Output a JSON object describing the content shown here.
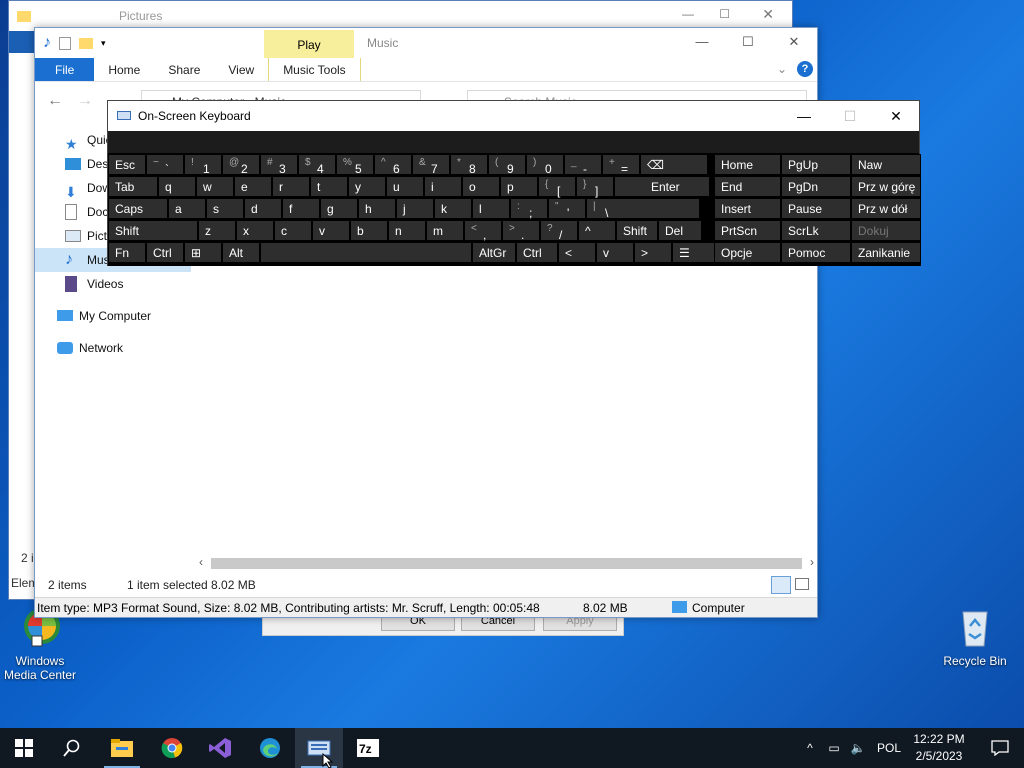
{
  "back_window": {
    "title": "Pictures"
  },
  "main_window": {
    "title": "Music",
    "context_tab": "Play",
    "ribbon_tabs": [
      "File",
      "Home",
      "Share",
      "View",
      "Music Tools"
    ],
    "address": "My Computer › Music",
    "search_placeholder": "Search Music",
    "nav_items": [
      {
        "label": "Quick access",
        "icon": "star-icon"
      },
      {
        "label": "Desktop",
        "icon": "desktop-icon"
      },
      {
        "label": "Downloads",
        "icon": "download-icon"
      },
      {
        "label": "Documents",
        "icon": "document-icon"
      },
      {
        "label": "Pictures",
        "icon": "pictures-icon",
        "pinned": true
      },
      {
        "label": "Music",
        "icon": "music-icon",
        "selected": true
      },
      {
        "label": "Videos",
        "icon": "video-icon"
      },
      {
        "label": "My Computer",
        "icon": "computer-icon"
      },
      {
        "label": "Network",
        "icon": "network-icon"
      }
    ],
    "status": {
      "items": "2 items",
      "selected": "1 item selected  8.02 MB"
    },
    "info": {
      "details": "Item type: MP3 Format Sound, Size: 8.02 MB, Contributing artists: Mr. Scruff, Length: 00:05:48",
      "size": "8.02 MB",
      "location": "Computer"
    }
  },
  "back_dialog": {
    "ok": "OK",
    "cancel": "Cancel",
    "apply": "Apply"
  },
  "back_window_side": {
    "items_count": "2 i",
    "elem": "Elem"
  },
  "osk": {
    "title": "On-Screen Keyboard",
    "rows": [
      [
        {
          "t": "Esc"
        },
        {
          "s": "~",
          "m": "`"
        },
        {
          "s": "!",
          "m": "1"
        },
        {
          "s": "@",
          "m": "2"
        },
        {
          "s": "#",
          "m": "3"
        },
        {
          "s": "$",
          "m": "4"
        },
        {
          "s": "%",
          "m": "5"
        },
        {
          "s": "^",
          "m": "6"
        },
        {
          "s": "&",
          "m": "7"
        },
        {
          "s": "*",
          "m": "8"
        },
        {
          "s": "(",
          "m": "9"
        },
        {
          "s": ")",
          "m": "0"
        },
        {
          "s": "_",
          "m": "-"
        },
        {
          "s": "+",
          "m": "="
        },
        {
          "t": "⌫"
        }
      ],
      [
        {
          "t": "Tab"
        },
        {
          "t": "q"
        },
        {
          "t": "w"
        },
        {
          "t": "e"
        },
        {
          "t": "r"
        },
        {
          "t": "t"
        },
        {
          "t": "y"
        },
        {
          "t": "u"
        },
        {
          "t": "i"
        },
        {
          "t": "o"
        },
        {
          "t": "p"
        },
        {
          "s": "{",
          "m": "["
        },
        {
          "s": "}",
          "m": "]"
        },
        {
          "t": "Enter"
        }
      ],
      [
        {
          "t": "Caps"
        },
        {
          "t": "a"
        },
        {
          "t": "s"
        },
        {
          "t": "d"
        },
        {
          "t": "f"
        },
        {
          "t": "g"
        },
        {
          "t": "h"
        },
        {
          "t": "j"
        },
        {
          "t": "k"
        },
        {
          "t": "l"
        },
        {
          "s": ":",
          "m": ";"
        },
        {
          "s": "\"",
          "m": "'"
        },
        {
          "s": "|",
          "m": "\\"
        }
      ],
      [
        {
          "t": "Shift"
        },
        {
          "t": "z"
        },
        {
          "t": "x"
        },
        {
          "t": "c"
        },
        {
          "t": "v"
        },
        {
          "t": "b"
        },
        {
          "t": "n"
        },
        {
          "t": "m"
        },
        {
          "s": "<",
          "m": ","
        },
        {
          "s": ">",
          "m": "."
        },
        {
          "s": "?",
          "m": "/"
        },
        {
          "t": "^"
        },
        {
          "t": "Shift"
        },
        {
          "t": "Del"
        }
      ],
      [
        {
          "t": "Fn"
        },
        {
          "t": "Ctrl"
        },
        {
          "t": "⊞"
        },
        {
          "t": "Alt"
        },
        {
          "t": ""
        },
        {
          "t": "AltGr"
        },
        {
          "t": "Ctrl"
        },
        {
          "t": "<"
        },
        {
          "t": "v"
        },
        {
          "t": ">"
        },
        {
          "t": "☰"
        }
      ]
    ],
    "side_keys": [
      [
        "Home",
        "PgUp",
        "Naw"
      ],
      [
        "End",
        "PgDn",
        "Prz w górę"
      ],
      [
        "Insert",
        "Pause",
        "Prz w dół"
      ],
      [
        "PrtScn",
        "ScrLk",
        "Dokuj"
      ],
      [
        "Opcje",
        "Pomoc",
        "Zanikanie"
      ]
    ]
  },
  "desktop": {
    "wmc": "Windows Media Center",
    "recycle": "Recycle Bin"
  },
  "taskbar": {
    "lang": "POL",
    "time": "12:22 PM",
    "date": "2/5/2023"
  }
}
